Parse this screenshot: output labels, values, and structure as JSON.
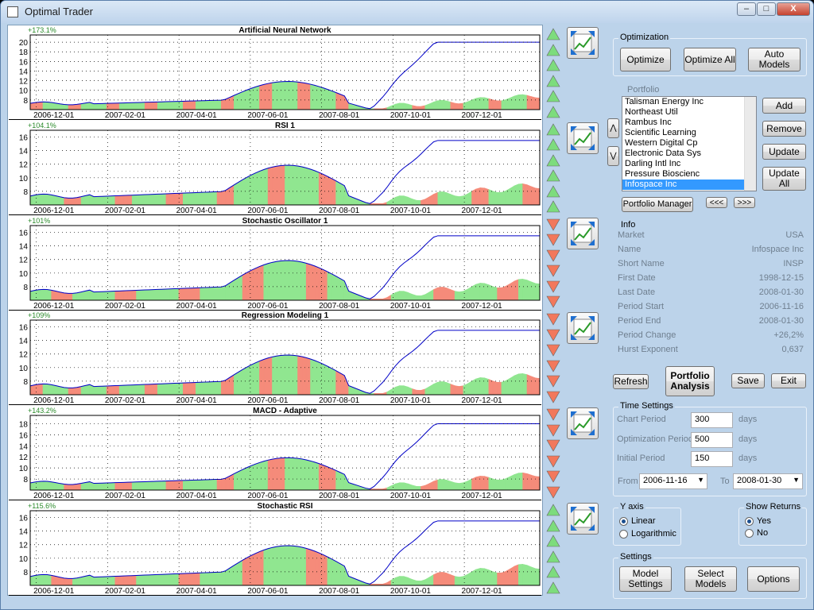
{
  "window": {
    "title": "Optimal Trader",
    "minimize": "‒",
    "maximize": "□",
    "close": "X"
  },
  "charts": [
    {
      "title": "Artificial Neural Network",
      "gain": "+173.1%",
      "yticks": [
        "20",
        "18",
        "16",
        "14",
        "12",
        "10",
        "8"
      ],
      "ymin": 6,
      "ymax": 21.5,
      "arrows": [
        "up",
        "up",
        "up",
        "up",
        "up",
        "up"
      ]
    },
    {
      "title": "RSI 1",
      "gain": "+104.1%",
      "yticks": [
        "16",
        "14",
        "12",
        "10",
        "8"
      ],
      "ymin": 6,
      "ymax": 17,
      "arrows": [
        "up",
        "up",
        "up",
        "up",
        "up",
        "up"
      ]
    },
    {
      "title": "Stochastic Oscillator 1",
      "gain": "+101%",
      "yticks": [
        "16",
        "14",
        "12",
        "10",
        "8"
      ],
      "ymin": 6,
      "ymax": 17,
      "arrows": [
        "down",
        "down",
        "down",
        "down",
        "down",
        "down"
      ]
    },
    {
      "title": "Regression Modeling 1",
      "gain": "+109%",
      "yticks": [
        "16",
        "14",
        "12",
        "10",
        "8"
      ],
      "ymin": 6,
      "ymax": 17,
      "arrows": [
        "down",
        "down",
        "down",
        "down",
        "down",
        "down"
      ]
    },
    {
      "title": "MACD - Adaptive",
      "gain": "+143.2%",
      "yticks": [
        "18",
        "16",
        "14",
        "12",
        "10",
        "8"
      ],
      "ymin": 6,
      "ymax": 19.5,
      "arrows": [
        "down",
        "down",
        "down",
        "down",
        "down",
        "down"
      ]
    },
    {
      "title": "Stochastic RSI",
      "gain": "+115.6%",
      "yticks": [
        "16",
        "14",
        "12",
        "10",
        "8"
      ],
      "ymin": 6,
      "ymax": 17,
      "arrows": [
        "up",
        "up",
        "up",
        "up",
        "up",
        "up"
      ]
    }
  ],
  "xaxis": [
    "2006-12-01",
    "2007-02-01",
    "2007-04-01",
    "2007-06-01",
    "2007-08-01",
    "2007-10-01",
    "2007-12-01"
  ],
  "optimization": {
    "title": "Optimization",
    "optimize": "Optimize",
    "optimize_all": "Optimize All",
    "auto_models": "Auto Models"
  },
  "portfolio": {
    "title": "Portfolio",
    "items": [
      "Talisman Energy Inc",
      "Northeast Util",
      "Rambus Inc",
      "Scientific Learning",
      "Western Digital Cp",
      "Electronic Data Sys",
      "Darling Intl Inc",
      "Pressure Bioscienc",
      "Infospace Inc"
    ],
    "selected": 8,
    "add": "Add",
    "remove": "Remove",
    "update": "Update",
    "update_all": "Update All",
    "manager": "Portfolio Manager",
    "prev": "<<<",
    "next": ">>>",
    "up": "⋀",
    "down": "⋁"
  },
  "info": {
    "title": "Info",
    "rows": [
      {
        "k": "Market",
        "v": "USA"
      },
      {
        "k": "Name",
        "v": "Infospace Inc"
      },
      {
        "k": "Short Name",
        "v": "INSP"
      },
      {
        "k": "First Date",
        "v": "1998-12-15"
      },
      {
        "k": "Last Date",
        "v": "2008-01-30"
      },
      {
        "k": "Period Start",
        "v": "2006-11-16"
      },
      {
        "k": "Period End",
        "v": "2008-01-30"
      },
      {
        "k": "Period Change",
        "v": "+26,2%"
      },
      {
        "k": "Hurst Exponent",
        "v": "0,637"
      }
    ]
  },
  "actions": {
    "refresh": "Refresh",
    "portfolio_analysis_1": "Portfolio",
    "portfolio_analysis_2": "Analysis",
    "save": "Save",
    "exit": "Exit"
  },
  "time": {
    "title": "Time Settings",
    "chart_period_label": "Chart Period",
    "chart_period": "300",
    "opt_period_label": "Optimization Period",
    "opt_period": "500",
    "init_period_label": "Initial Period",
    "init_period": "150",
    "unit": "days",
    "from_label": "From",
    "from": "2006-11-16",
    "to_label": "To",
    "to": "2008-01-30"
  },
  "yaxis": {
    "title": "Y axis",
    "linear": "Linear",
    "log": "Logarithmic",
    "selected": "Linear"
  },
  "returns": {
    "title": "Show Returns",
    "yes": "Yes",
    "no": "No",
    "selected": "Yes"
  },
  "settings": {
    "title": "Settings",
    "model1": "Model",
    "model2": "Settings",
    "select1": "Select",
    "select2": "Models",
    "options": "Options"
  },
  "colors": {
    "green": "#90e690",
    "red": "#f58b7a",
    "line": "#0000c8",
    "up": "#7ddc7d",
    "down": "#f2785c"
  }
}
